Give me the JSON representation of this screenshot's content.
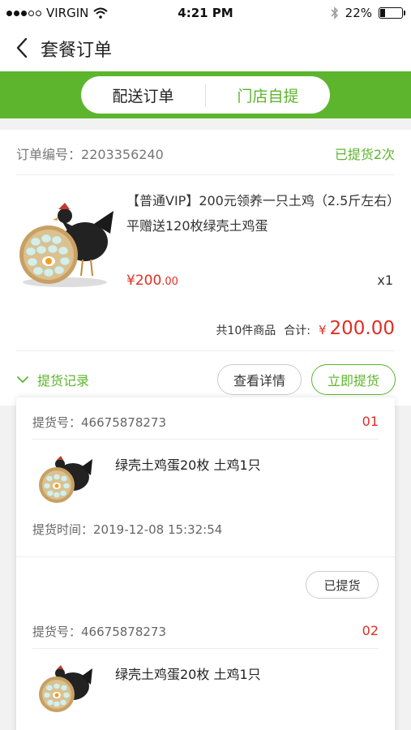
{
  "status_bar": {
    "carrier": "VIRGIN",
    "time": "4:21 PM",
    "battery": "22%",
    "battery_level": 0.22
  },
  "nav": {
    "title": "套餐订单"
  },
  "tabs": [
    {
      "label": "配送订单",
      "active": true
    },
    {
      "label": "门店自提",
      "active": false
    }
  ],
  "order": {
    "number_label": "订单编号：",
    "number": "2203356240",
    "status": "已提货2次",
    "product_name": "【普通VIP】200元领养一只土鸡（2.5斤左右）平赠送120枚绿壳土鸡蛋",
    "price_symbol": "¥",
    "price_int": "200",
    "price_dec": ".00",
    "quantity": "x1",
    "count_text": "共10件商品",
    "total_label": "合计:",
    "total_symbol": "¥",
    "total": "200.00"
  },
  "actions": {
    "records_label": "提货记录",
    "detail_button": "查看详情",
    "pickup_button": "立即提货"
  },
  "records": [
    {
      "no_label": "提货号：",
      "no": "46675878273",
      "index": "01",
      "goods": "绿壳土鸡蛋20枚  土鸡1只",
      "time_label": "提货时间：",
      "time": "2019-12-08 15:32:54",
      "status_button": "已提货"
    },
    {
      "no_label": "提货号：",
      "no": "46675878273",
      "index": "02",
      "goods": "绿壳土鸡蛋20枚  土鸡1只"
    }
  ],
  "colors": {
    "accent": "#5db52e",
    "price": "#e02e24"
  }
}
